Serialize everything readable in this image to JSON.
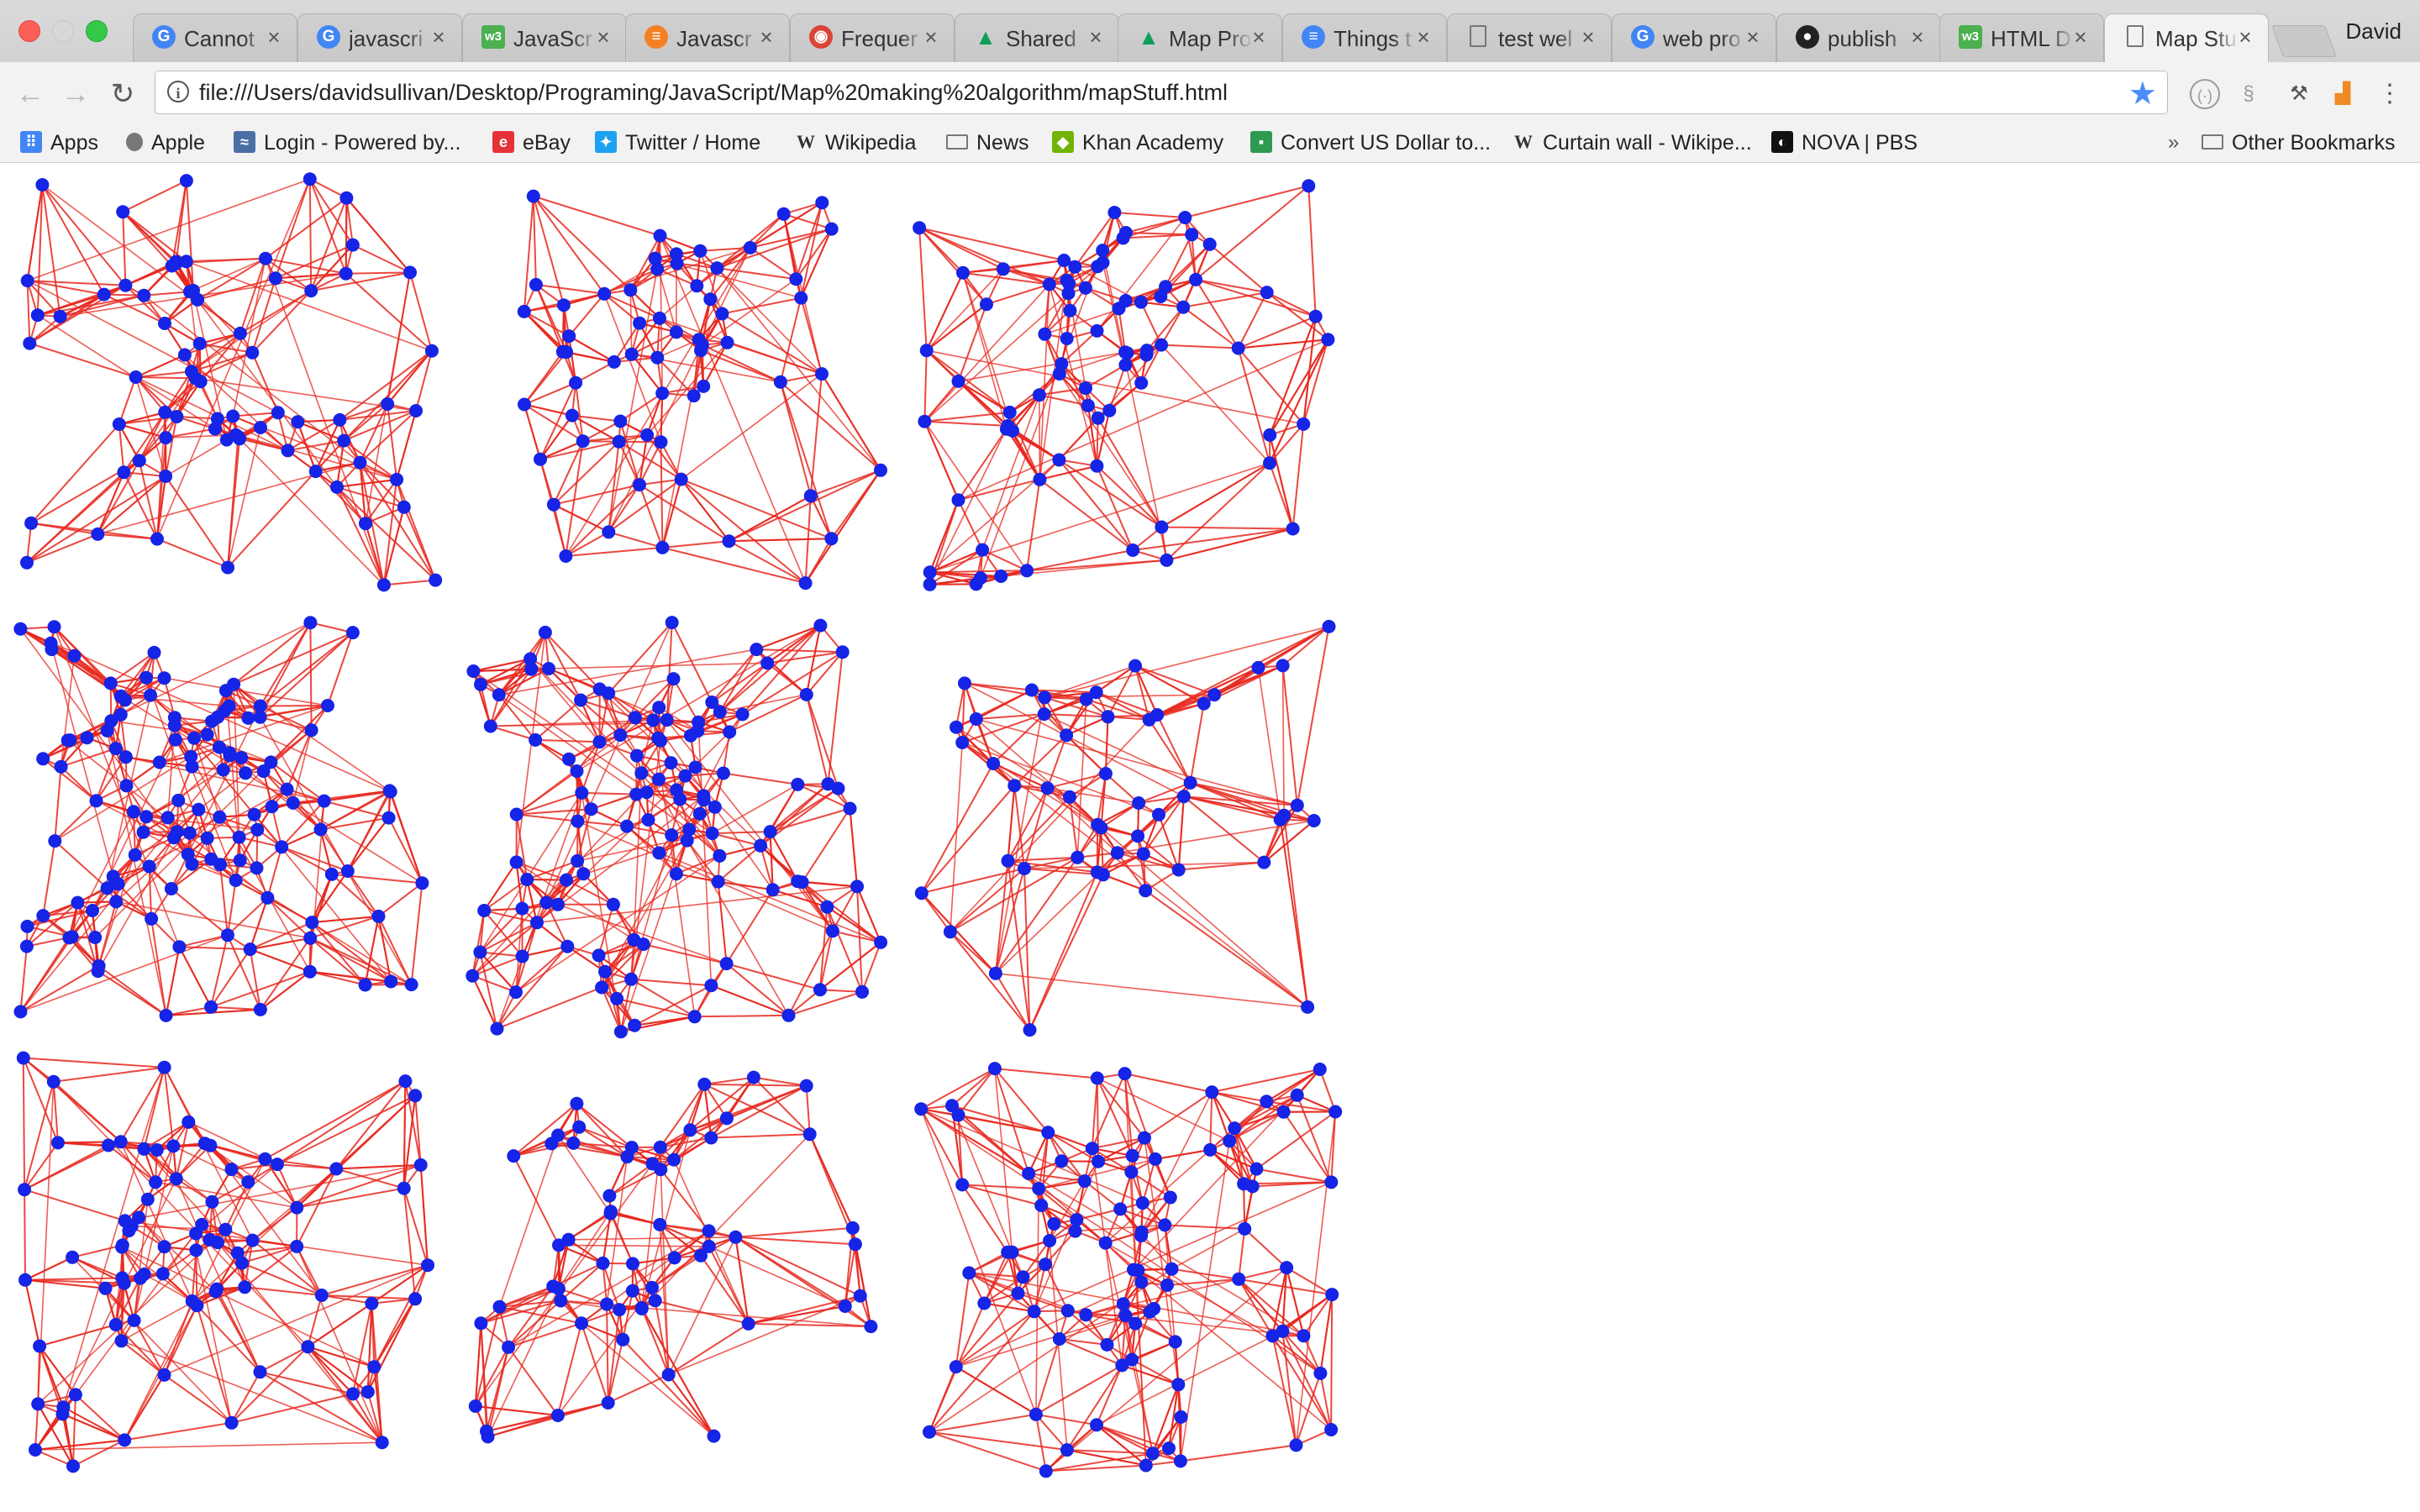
{
  "window": {
    "user": "David"
  },
  "tabs": [
    {
      "label": "Cannot",
      "icon": "google-icon",
      "color": "#4285f4"
    },
    {
      "label": "javascri",
      "icon": "google-icon",
      "color": "#4285f4"
    },
    {
      "label": "JavaScr",
      "icon": "w3schools-icon",
      "color": "#4caf50"
    },
    {
      "label": "Javascr",
      "icon": "stackoverflow-icon",
      "color": "#f48024"
    },
    {
      "label": "Frequer",
      "icon": "chrome-icon",
      "color": "#db4437"
    },
    {
      "label": "Shared",
      "icon": "drive-icon",
      "color": "#0f9d58"
    },
    {
      "label": "Map Pro",
      "icon": "drive-icon",
      "color": "#0f9d58"
    },
    {
      "label": "Things t",
      "icon": "docs-icon",
      "color": "#4285f4"
    },
    {
      "label": "test wel",
      "icon": "page-icon",
      "color": "#888888"
    },
    {
      "label": "web pro",
      "icon": "google-icon",
      "color": "#4285f4"
    },
    {
      "label": "publish",
      "icon": "github-icon",
      "color": "#222222"
    },
    {
      "label": "HTML D",
      "icon": "w3schools-icon",
      "color": "#4caf50"
    },
    {
      "label": "Map Stu",
      "icon": "page-icon",
      "color": "#888888",
      "active": true
    }
  ],
  "toolbar": {
    "url": "file:///Users/davidsullivan/Desktop/Programing/JavaScript/Map%20making%20algorithm/mapStuff.html"
  },
  "bookmarks": [
    {
      "label": "Apps",
      "icon": "apps-grid-icon"
    },
    {
      "label": "Apple",
      "icon": "apple-icon"
    },
    {
      "label": "Login - Powered by...",
      "icon": "login-icon"
    },
    {
      "label": "eBay",
      "icon": "ebay-icon"
    },
    {
      "label": "Twitter / Home",
      "icon": "twitter-icon"
    },
    {
      "label": "Wikipedia",
      "icon": "wikipedia-icon"
    },
    {
      "label": "News",
      "icon": "folder-icon"
    },
    {
      "label": "Khan Academy",
      "icon": "khan-academy-icon"
    },
    {
      "label": "Convert US Dollar to...",
      "icon": "currency-icon"
    },
    {
      "label": "Curtain wall - Wikipe...",
      "icon": "wikipedia-icon"
    },
    {
      "label": "NOVA | PBS",
      "icon": "pbs-icon"
    }
  ],
  "bookmarks_overflow": "»",
  "other_bookmarks": "Other Bookmarks",
  "map": {
    "edge_color": "#e8281e",
    "node_color": "#1524e6",
    "grid": [
      3,
      3
    ],
    "seed": 42
  }
}
